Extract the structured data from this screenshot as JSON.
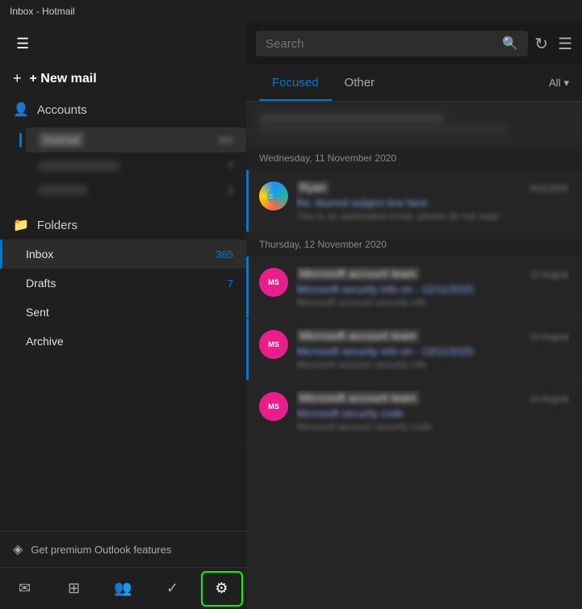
{
  "titleBar": {
    "title": "Inbox - Hotmail"
  },
  "sidebar": {
    "hamburgerLabel": "☰",
    "newMailLabel": "+ New mail",
    "accountsLabel": "Accounts",
    "accountsIcon": "👤",
    "accounts": [
      {
        "name": "Hotmail",
        "badge": "365",
        "active": true
      },
      {
        "name": "Account2",
        "badge": "7",
        "active": false
      },
      {
        "name": "Office",
        "badge": "2",
        "active": false
      }
    ],
    "foldersLabel": "Folders",
    "folders": [
      {
        "name": "Inbox",
        "badge": "365",
        "active": true
      },
      {
        "name": "Drafts",
        "badge": "7",
        "active": false
      },
      {
        "name": "Sent",
        "badge": "",
        "active": false
      },
      {
        "name": "Archive",
        "badge": "",
        "active": false
      }
    ],
    "premiumLabel": "Get premium Outlook features",
    "premiumIcon": "◈"
  },
  "bottomNav": {
    "items": [
      {
        "name": "mail-nav",
        "icon": "✉",
        "active": false
      },
      {
        "name": "calendar-nav",
        "icon": "⊞",
        "active": false
      },
      {
        "name": "people-nav",
        "icon": "👥",
        "active": false
      },
      {
        "name": "tasks-nav",
        "icon": "✓",
        "active": false
      },
      {
        "name": "settings-nav",
        "icon": "⚙",
        "active": true,
        "highlighted": true
      }
    ]
  },
  "rightPanel": {
    "search": {
      "placeholder": "Search",
      "searchIcon": "🔍"
    },
    "toolbar": {
      "refreshIcon": "↻",
      "filterIcon": "☰"
    },
    "tabs": [
      {
        "name": "Focused",
        "active": true
      },
      {
        "name": "Other",
        "active": false
      }
    ],
    "filterLabel": "All",
    "filterDropIcon": "▾",
    "emails": [
      {
        "type": "blurred",
        "date": ""
      },
      {
        "dateDivider": "Wednesday, 11 November 2020"
      },
      {
        "sender": "Ryan",
        "subject": "Re: blurred subject",
        "preview": "This is an automated email, please",
        "time": "6/11/2020",
        "avatar": "globe",
        "unread": true
      },
      {
        "dateDivider": "Thursday, 12 November 2020"
      },
      {
        "sender": "Microsoft account team",
        "subject": "Microsoft security info on - 12/11/2020",
        "preview": "Microsoft account security info",
        "time": "12 August",
        "avatar": "ms",
        "unread": true
      },
      {
        "sender": "Microsoft account team",
        "subject": "Microsoft security info on - 13/11/2020",
        "preview": "Microsoft account security info",
        "time": "13 August",
        "avatar": "ms",
        "unread": true
      },
      {
        "sender": "Microsoft account team",
        "subject": "Microsoft security code",
        "preview": "Microsoft account security code",
        "time": "14 August",
        "avatar": "ms",
        "unread": false
      }
    ]
  }
}
